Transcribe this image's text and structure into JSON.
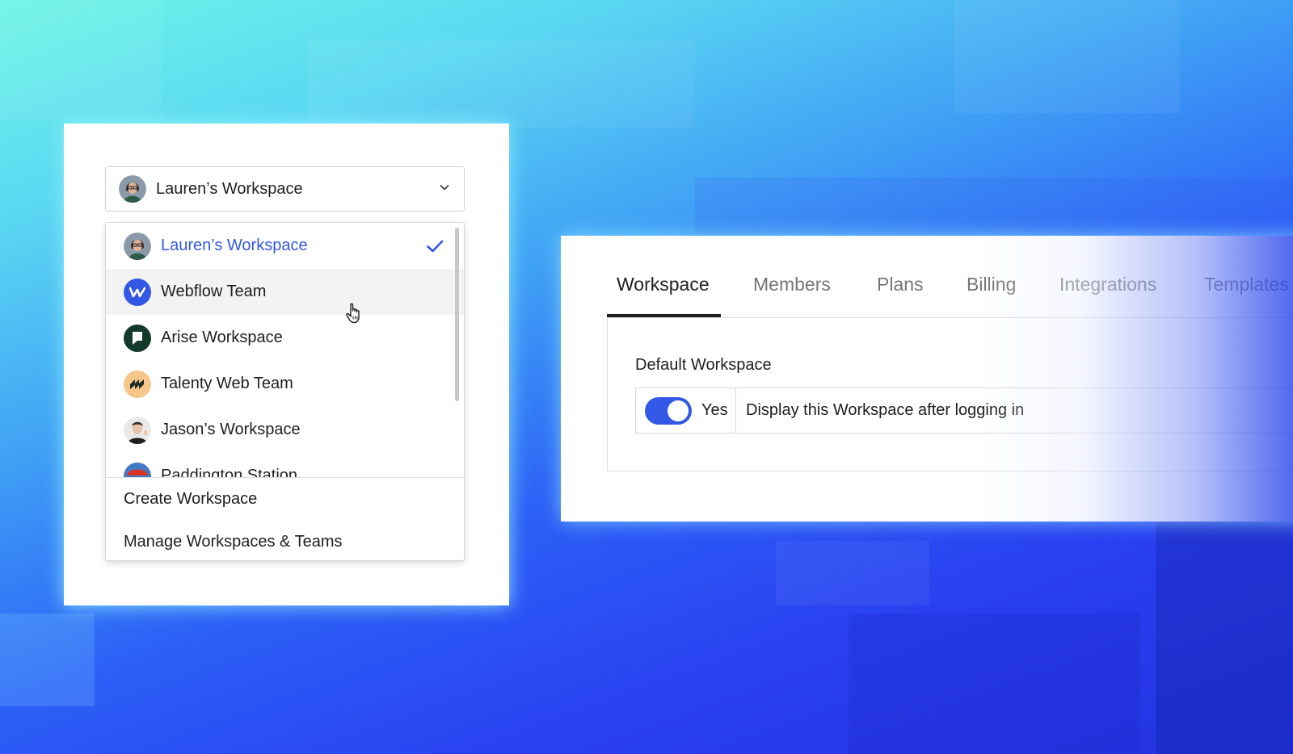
{
  "colors": {
    "accent": "#3358e6",
    "text": "#1f1f1f",
    "muted_text": "#757575"
  },
  "switcher": {
    "current": {
      "label": "Lauren’s Workspace",
      "avatar_icon": "user-avatar-lauren"
    },
    "items": [
      {
        "name": "Lauren’s Workspace",
        "icon": "user-avatar-lauren",
        "selected": true
      },
      {
        "name": "Webflow Team",
        "icon": "webflow-logo-icon",
        "selected": false
      },
      {
        "name": "Arise Workspace",
        "icon": "arise-logo-icon",
        "selected": false
      },
      {
        "name": "Talenty Web Team",
        "icon": "talenty-logo-icon",
        "selected": false
      },
      {
        "name": "Jason’s Workspace",
        "icon": "user-avatar-jason",
        "selected": false
      },
      {
        "name": "Paddington Station",
        "icon": "paddington-avatar",
        "selected": false
      }
    ],
    "actions": {
      "create": "Create Workspace",
      "manage": "Manage Workspaces & Teams"
    }
  },
  "settings": {
    "tabs": [
      "Workspace",
      "Members",
      "Plans",
      "Billing",
      "Integrations",
      "Templates"
    ],
    "active_tab": "Workspace",
    "section_label": "Default Workspace",
    "toggle": {
      "state_label": "Yes",
      "on": true
    },
    "description": "Display this Workspace after logging in"
  }
}
